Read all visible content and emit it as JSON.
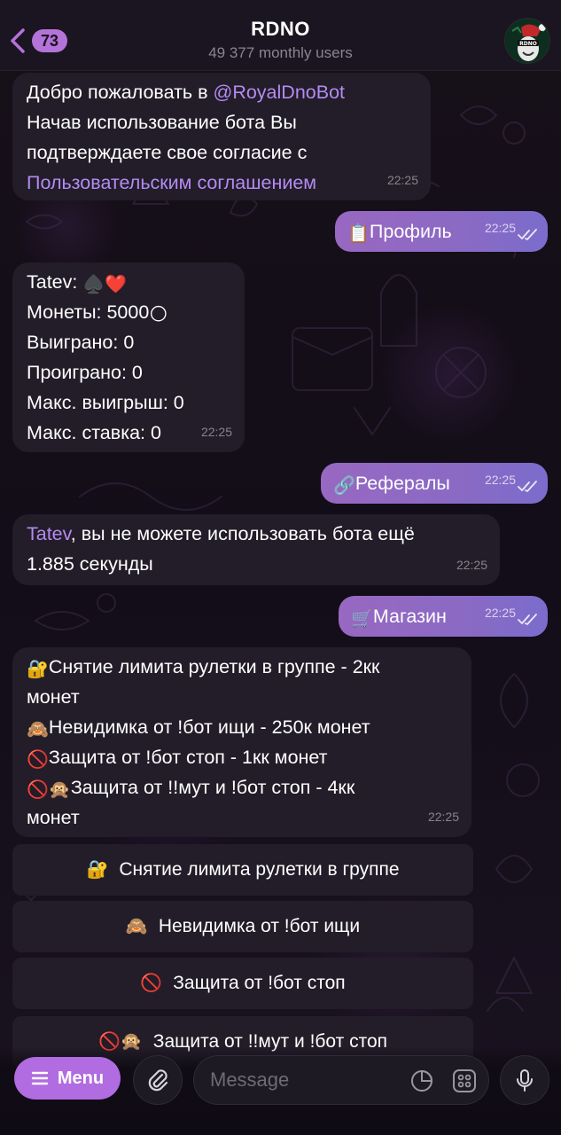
{
  "header": {
    "back_count": "73",
    "title": "RDNO",
    "subtitle": "49 377 monthly users",
    "avatar_label": "RDNO"
  },
  "messages": {
    "welcome": {
      "line1_prefix": "Добро пожаловать в ",
      "bot_mention": "@RoyalDnoBot",
      "line2": "Начав использование бота Вы",
      "line3": "подтверждаете свое согласие с",
      "agreement_link": "Пользовательским соглашением",
      "time": "22:25"
    },
    "cmd_profile": {
      "emoji": "📋",
      "text": "Профиль",
      "time": "22:25"
    },
    "profile": {
      "name_line": "Tatev: ",
      "name_emoji": "♠️❤️",
      "coins_line": "Монеты: 5000",
      "coins_emoji": "🌕",
      "won_line": "Выиграно: 0",
      "lost_line": "Проиграно: 0",
      "max_win_line": "Макс. выигрыш: 0",
      "max_bet_line": "Макс. ставка: 0",
      "time": "22:25"
    },
    "cmd_referrals": {
      "emoji": "🔗",
      "text": "Рефералы",
      "time": "22:25"
    },
    "cooldown": {
      "user_link": "Tatev",
      "text_1": ", вы не можете использовать бота ещё",
      "text_2": "1.885 секунды",
      "time": "22:25"
    },
    "cmd_shop": {
      "emoji": "🛒",
      "text": "Магазин",
      "time": "22:25"
    },
    "shop": {
      "item1_emoji": "🔐",
      "item1_a": "Снятие лимита рулетки в группе - 2кк",
      "item1_b": "монет",
      "item2_emoji": "🙈",
      "item2": "Невидимка от !бот ищи - 250к монет",
      "item3_emoji": "🚫",
      "item3": "Защита от !бот стоп - 1кк монет",
      "item4_emoji": "🚫🙊",
      "item4_a": "Защита от !!мут и !бот стоп - 4кк",
      "item4_b": "монет",
      "time": "22:25"
    }
  },
  "keyboard": [
    {
      "emoji": "🔐",
      "label": "Снятие лимита рулетки в группе"
    },
    {
      "emoji": "🙈",
      "label": "Невидимка от !бот ищи"
    },
    {
      "emoji": "🚫",
      "label": "Защита от !бот стоп"
    },
    {
      "emoji": "🚫🙊",
      "label": "Защита от !!мут и !бот стоп"
    }
  ],
  "composer": {
    "menu_label": "Menu",
    "placeholder": "Message"
  },
  "colors": {
    "accent": "#b06ce0",
    "link": "#b58af2",
    "incoming_bubble": "#221d29",
    "outgoing_bubble": "#9868c2"
  }
}
